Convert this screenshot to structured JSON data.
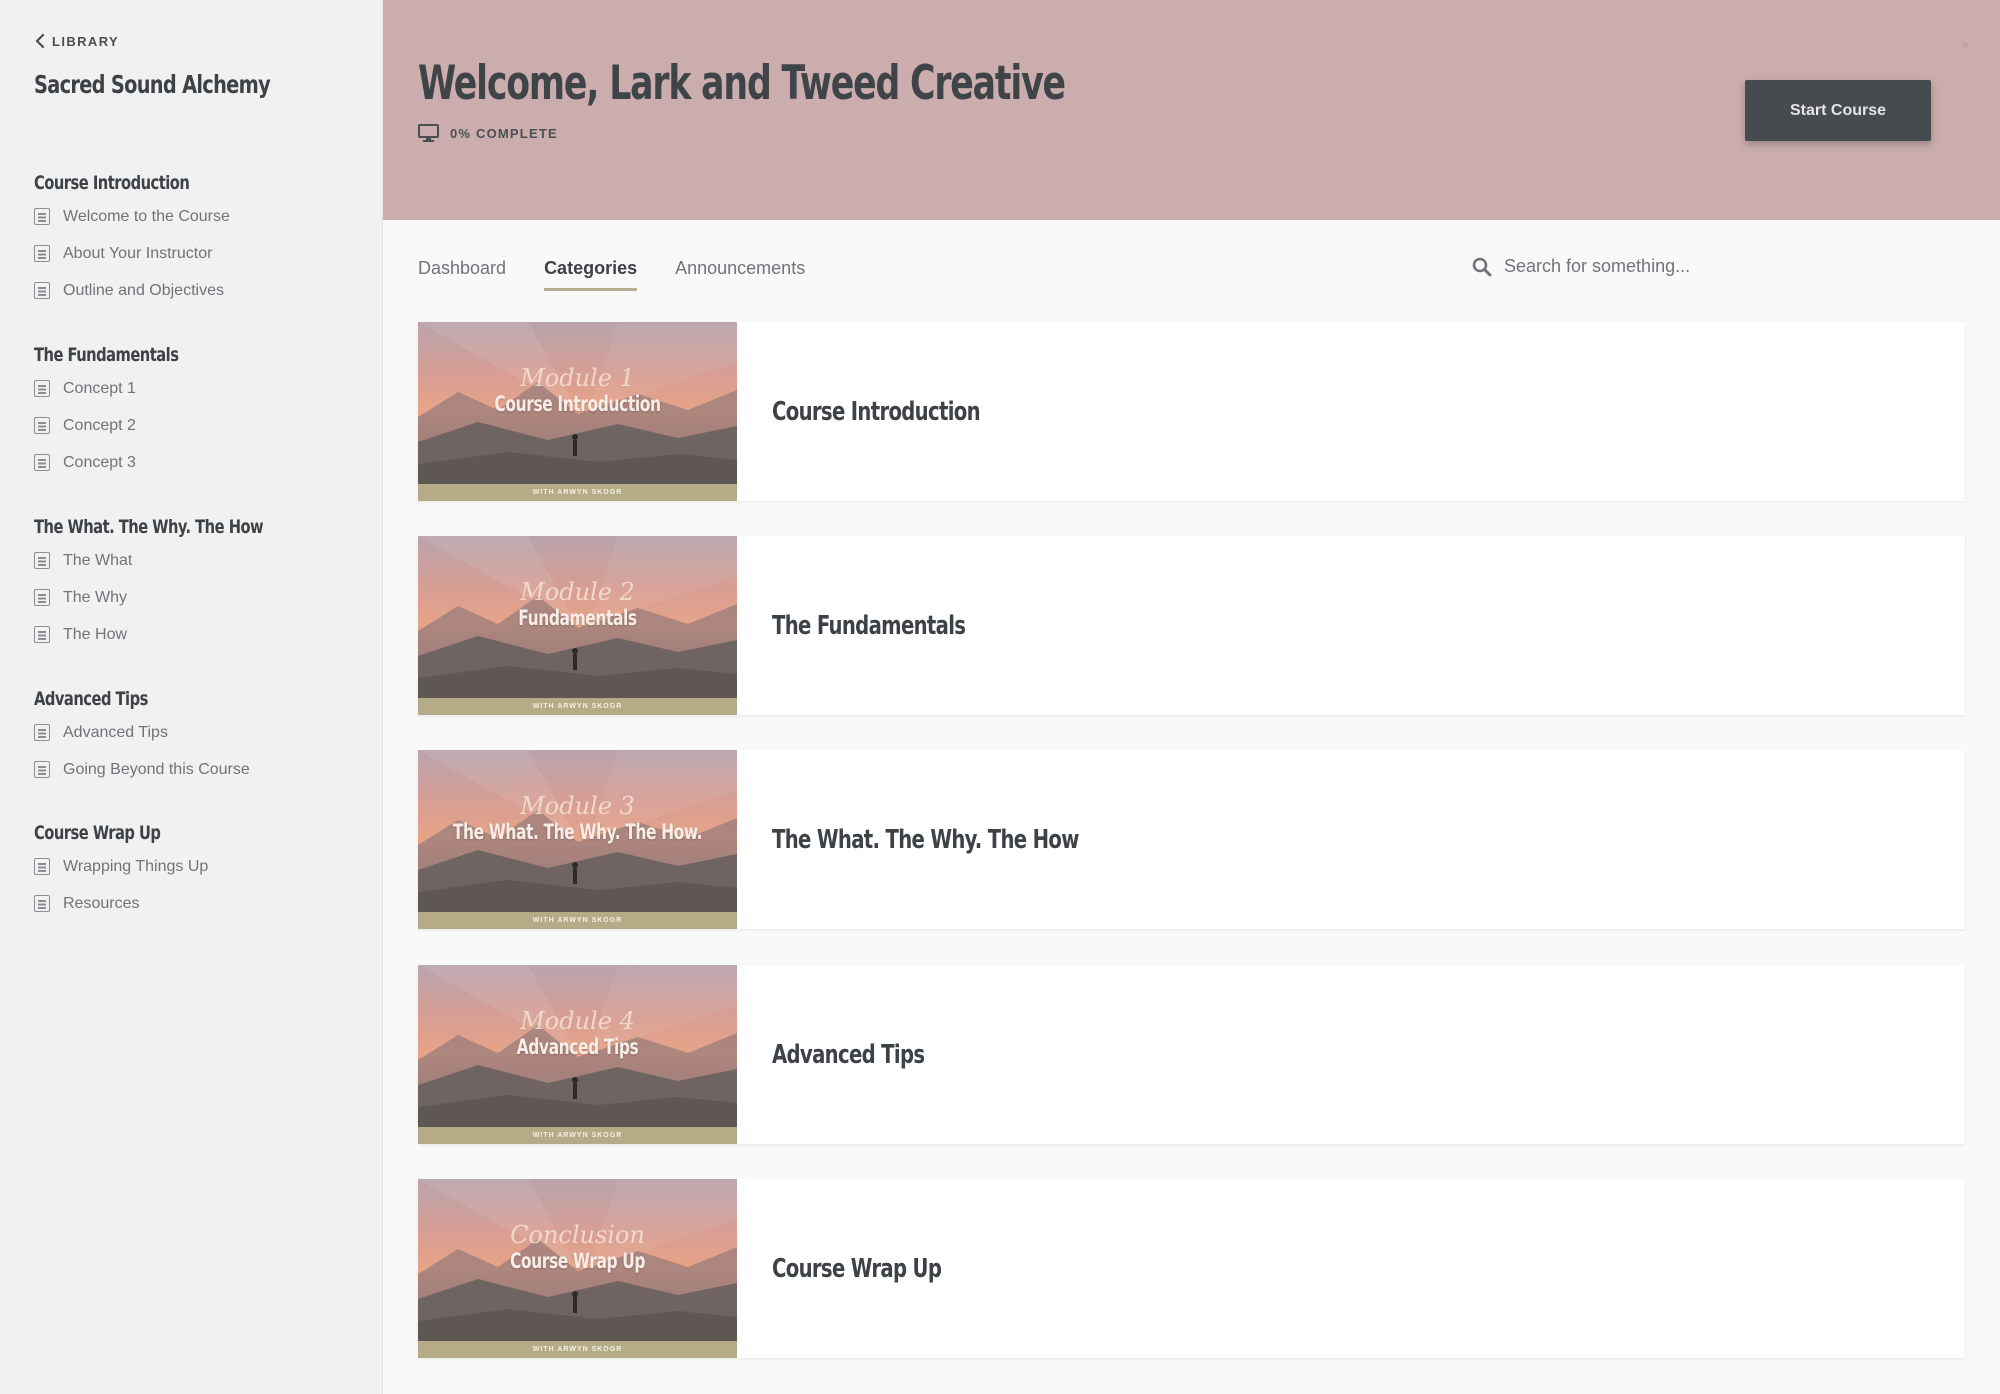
{
  "sidebar": {
    "back_label": "LIBRARY",
    "course_title": "Sacred Sound Alchemy",
    "sections": [
      {
        "title": "Course Introduction",
        "lessons": [
          "Welcome to the Course",
          "About Your Instructor",
          "Outline and Objectives"
        ]
      },
      {
        "title": "The Fundamentals",
        "lessons": [
          "Concept 1",
          "Concept 2",
          "Concept 3"
        ]
      },
      {
        "title": "The What. The Why. The How",
        "lessons": [
          "The What",
          "The Why",
          "The How"
        ]
      },
      {
        "title": "Advanced Tips",
        "lessons": [
          "Advanced Tips",
          "Going Beyond this Course"
        ]
      },
      {
        "title": "Course Wrap Up",
        "lessons": [
          "Wrapping Things Up",
          "Resources"
        ]
      }
    ]
  },
  "header": {
    "welcome": "Welcome, Lark and Tweed Creative",
    "progress_label": "0% COMPLETE",
    "start_button": "Start Course",
    "background": "#cbadad"
  },
  "tabs": [
    {
      "label": "Dashboard",
      "active": false
    },
    {
      "label": "Categories",
      "active": true
    },
    {
      "label": "Announcements",
      "active": false
    }
  ],
  "search": {
    "placeholder": "Search for something..."
  },
  "categories": [
    {
      "title": "Course Introduction",
      "thumb_script": "Module 1",
      "thumb_title": "Course Introduction",
      "thumb_band": "WITH ARWYN SKOGR"
    },
    {
      "title": "The Fundamentals",
      "thumb_script": "Module 2",
      "thumb_title": "Fundamentals",
      "thumb_band": "WITH ARWYN SKOGR"
    },
    {
      "title": "The What. The Why. The How",
      "thumb_script": "Module 3",
      "thumb_title": "The What. The Why. The How.",
      "thumb_band": "WITH ARWYN SKOGR"
    },
    {
      "title": "Advanced Tips",
      "thumb_script": "Module 4",
      "thumb_title": "Advanced Tips",
      "thumb_band": "WITH ARWYN SKOGR"
    },
    {
      "title": "Course Wrap Up",
      "thumb_script": "Conclusion",
      "thumb_title": "Course Wrap Up",
      "thumb_band": "WITH ARWYN SKOGR"
    }
  ]
}
